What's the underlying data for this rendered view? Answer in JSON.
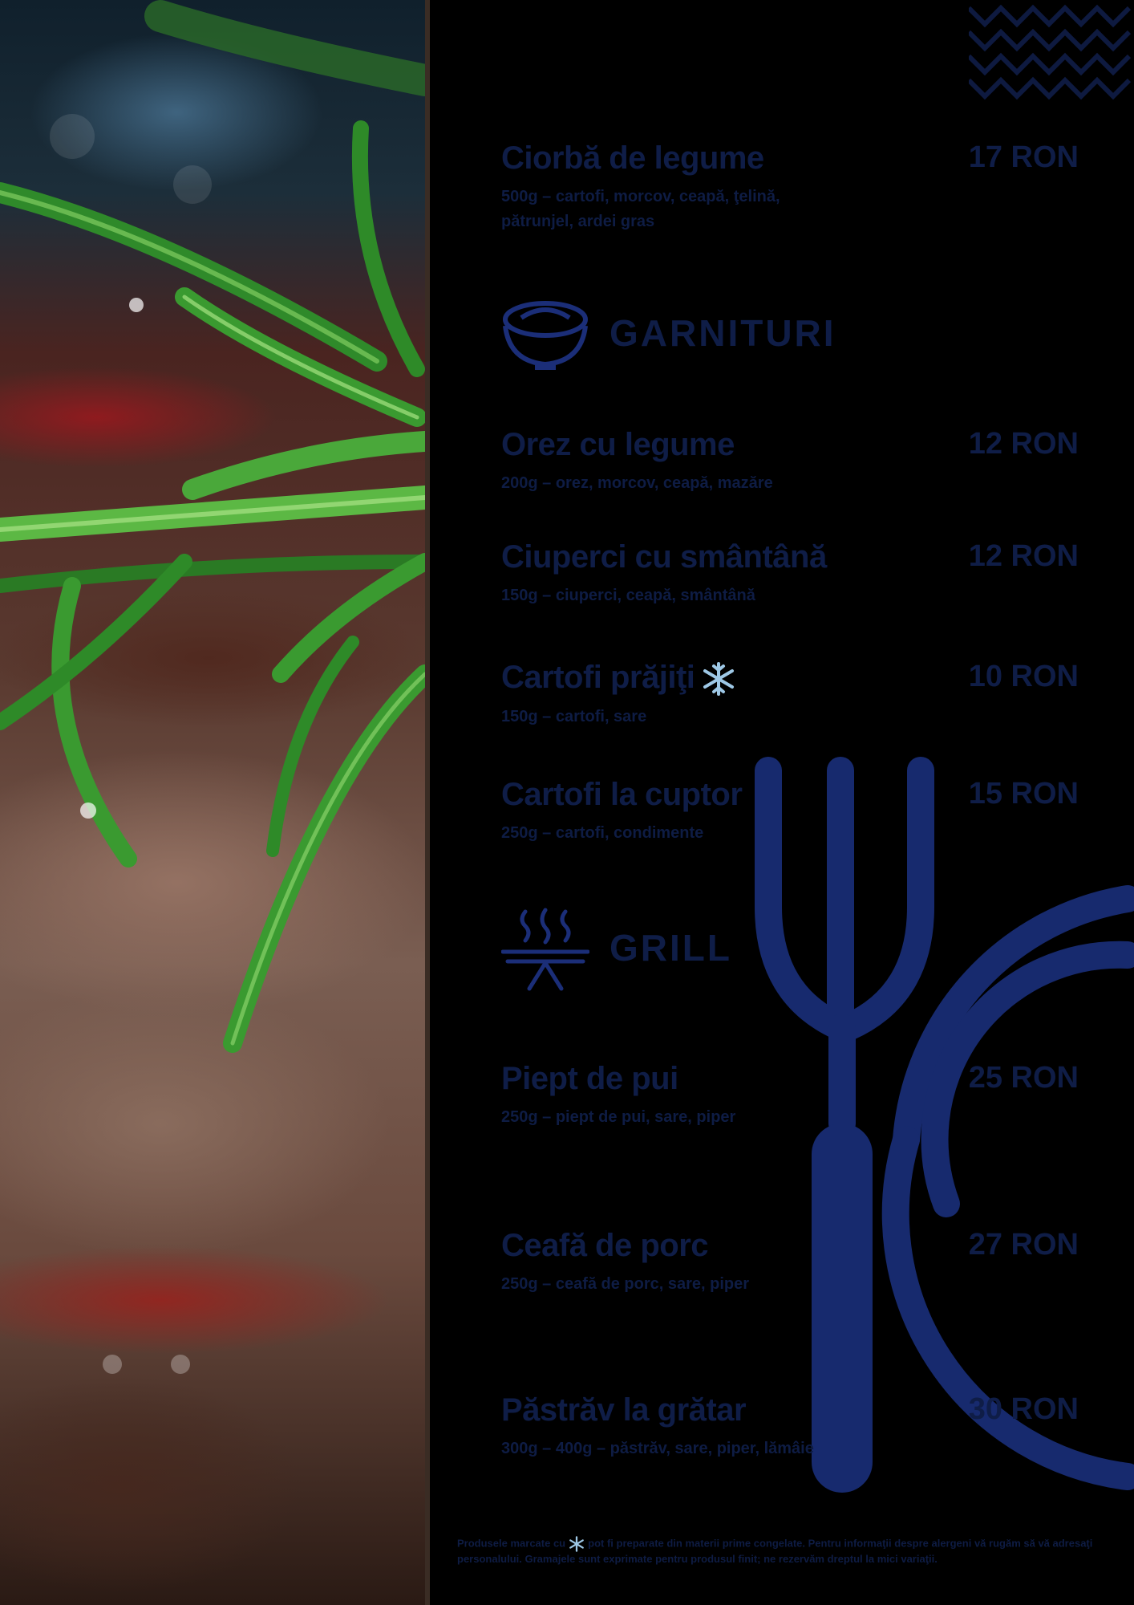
{
  "photo": {
    "alt_icon": "steak-rosemary-photo"
  },
  "sections": {
    "garnituri_title": "GARNITURI",
    "grill_title": "GRILL"
  },
  "items": [
    {
      "name": "Ciorbă de legume",
      "price": "17 RON",
      "desc": "500g – cartofi, morcov, ceapă, ţelină, pătrunjel, ardei gras"
    },
    {
      "name": "Orez cu legume",
      "price": "12 RON",
      "desc": "200g – orez, morcov, ceapă, mazăre"
    },
    {
      "name": "Ciuperci cu smântână",
      "price": "12 RON",
      "desc": "150g – ciuperci, ceapă, smântână"
    },
    {
      "name": "Cartofi prăjiţi",
      "price": "10 RON",
      "desc": "150g – cartofi, sare"
    },
    {
      "name": "Cartofi la cuptor",
      "price": "15 RON",
      "desc": "250g – cartofi, condimente"
    },
    {
      "name": "Piept de pui",
      "price": "25 RON",
      "desc": "250g – piept de pui, sare, piper"
    },
    {
      "name": "Ceafă de porc",
      "price": "27 RON",
      "desc": "250g – ceafă de porc, sare, piper"
    },
    {
      "name": "Păstrăv la grătar",
      "price": "30 RON",
      "desc": "300g – 400g – păstrăv, sare, piper, lămâie"
    }
  ],
  "footnote": {
    "before": "Produsele marcate cu",
    "after": "pot fi preparate din materii prime congelate. Pentru informaţii despre alergeni vă rugăm să vă adresaţi personalului. Gramajele sunt exprimate pentru produsul finit; ne rezervăm dreptul la mici variaţii."
  },
  "colors": {
    "background": "#000000",
    "text": "#0f1d47",
    "accent": "#1b2e78",
    "snowflake": "#9ec8e6"
  },
  "icons": [
    "zigzag-decoration",
    "bowl-icon",
    "grill-icon",
    "fork-plate-decoration",
    "snowflake-icon"
  ]
}
